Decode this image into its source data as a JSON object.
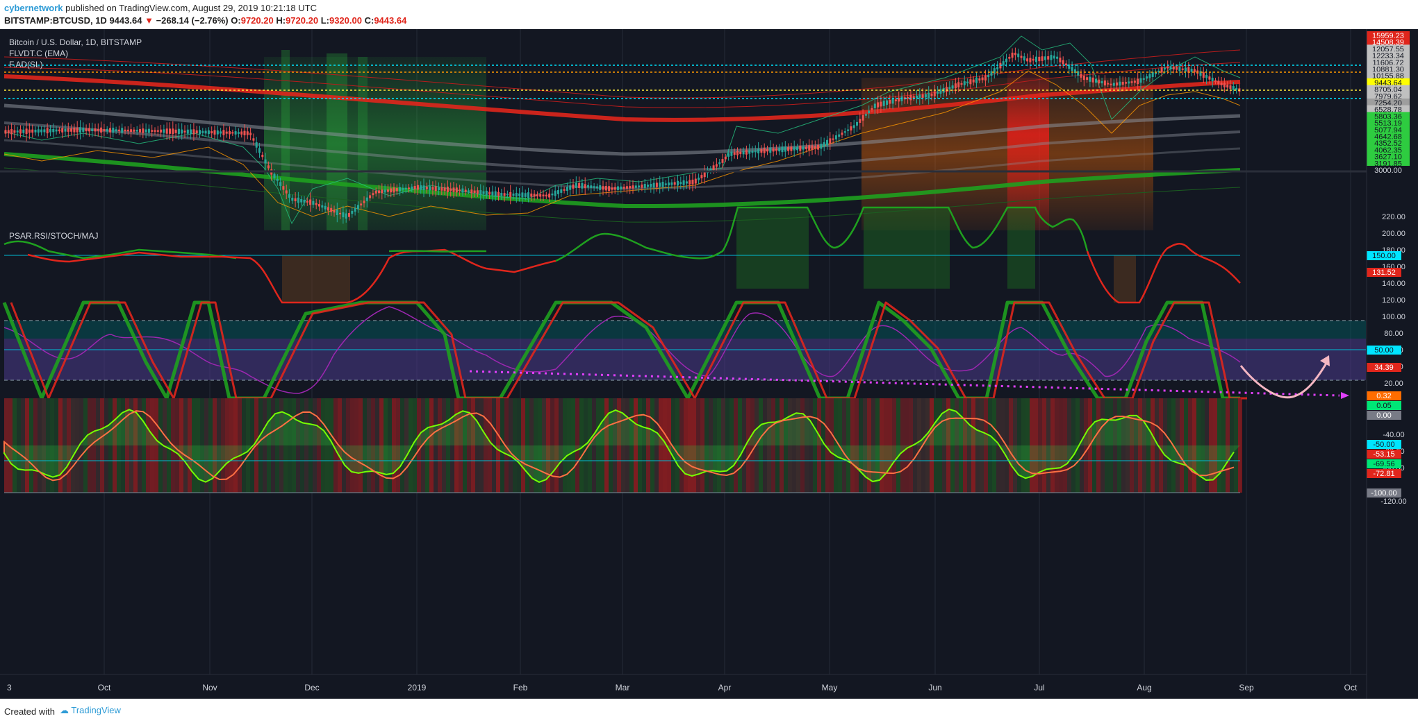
{
  "header": {
    "author": "cybernetwork",
    "published_text": " published on TradingView.com, August 29, 2019 10:21:18 UTC",
    "symbol": "BITSTAMP:BTCUSD, 1D",
    "last": "9443.64",
    "change_arrow": "▼",
    "change": "−268.14 (−2.76%)",
    "ohlc_o_label": "O:",
    "ohlc_o": "9720.20",
    "ohlc_h_label": "H:",
    "ohlc_h": "9720.20",
    "ohlc_l_label": "L:",
    "ohlc_l": "9320.00",
    "ohlc_c_label": "C:",
    "ohlc_c": "9443.64"
  },
  "panes": {
    "main_title": "Bitcoin / U.S. Dollar, 1D, BITSTAMP",
    "indicator_1": "FLVDT.C (EMA)",
    "indicator_2": "F.AD(SL)",
    "lower_title": "PSAR.RSI/STOCH/MAJ"
  },
  "price_axis": {
    "ticks": [
      {
        "label": "15959.23",
        "color": "#e0261c",
        "text_color": "#ffffff"
      },
      {
        "label": "14508.39",
        "color": "#e0261c",
        "text_color": "#ffffff"
      },
      {
        "label": "12057.55",
        "color": "#c0c0c0",
        "text_color": "#131722"
      },
      {
        "label": "12233.34",
        "color": "#c0c0c0",
        "text_color": "#131722"
      },
      {
        "label": "11606.72",
        "color": "#c0c0c0",
        "text_color": "#131722"
      },
      {
        "label": "10881.30",
        "color": "#c0c0c0",
        "text_color": "#131722"
      },
      {
        "label": "10155.88",
        "color": "#c0c0c0",
        "text_color": "#131722"
      },
      {
        "label": "9443.64",
        "color": "#ffff00",
        "text_color": "#131722"
      },
      {
        "label": "8705.04",
        "color": "#c0c0c0",
        "text_color": "#131722"
      },
      {
        "label": "7979.62",
        "color": "#c0c0c0",
        "text_color": "#131722"
      },
      {
        "label": "7254.20",
        "color": "#9e9e9e",
        "text_color": "#131722"
      },
      {
        "label": "6528.78",
        "color": "#c0c0c0",
        "text_color": "#131722"
      },
      {
        "label": "5803.36",
        "color": "#2ecc40",
        "text_color": "#131722"
      },
      {
        "label": "5513.19",
        "color": "#2ecc40",
        "text_color": "#131722"
      },
      {
        "label": "5077.94",
        "color": "#2ecc40",
        "text_color": "#131722"
      },
      {
        "label": "4642.68",
        "color": "#2ecc40",
        "text_color": "#131722"
      },
      {
        "label": "4352.52",
        "color": "#2ecc40",
        "text_color": "#131722"
      },
      {
        "label": "4062.35",
        "color": "#2ecc40",
        "text_color": "#131722"
      },
      {
        "label": "3627.10",
        "color": "#2ecc40",
        "text_color": "#131722"
      },
      {
        "label": "3191.85",
        "color": "#2ecc40",
        "text_color": "#131722"
      },
      {
        "label": "3000.00",
        "color": "#131722",
        "text_color": "#d1d4dc"
      }
    ]
  },
  "osc_axis": {
    "ticks": [
      "220.00",
      "200.00",
      "180.00",
      "160.00",
      "140.00",
      "120.00",
      "100.00",
      "80.00",
      "60.00",
      "40.00",
      "20.00",
      "-40.00",
      "-60.00",
      "-80.00",
      "-120.00"
    ],
    "tags": [
      {
        "label": "150.00",
        "color": "#00e5ff",
        "text_color": "#131722"
      },
      {
        "label": "131.52",
        "color": "#e0261c",
        "text_color": "#ffffff"
      },
      {
        "label": "50.00",
        "color": "#00e5ff",
        "text_color": "#131722"
      },
      {
        "label": "34.39",
        "color": "#e0261c",
        "text_color": "#ffffff"
      },
      {
        "label": "0.32",
        "color": "#ff6d00",
        "text_color": "#ffffff"
      },
      {
        "label": "0.05",
        "color": "#00e676",
        "text_color": "#131722"
      },
      {
        "label": "0.00",
        "color": "#787b86",
        "text_color": "#ffffff"
      },
      {
        "label": "-50.00",
        "color": "#00e5ff",
        "text_color": "#131722"
      },
      {
        "label": "-53.15",
        "color": "#e0261c",
        "text_color": "#ffffff"
      },
      {
        "label": "-69.56",
        "color": "#00e676",
        "text_color": "#131722"
      },
      {
        "label": "-72.81",
        "color": "#e0261c",
        "text_color": "#ffffff"
      },
      {
        "label": "-100.00",
        "color": "#787b86",
        "text_color": "#ffffff"
      }
    ]
  },
  "time_axis": {
    "labels": [
      "3",
      "Oct",
      "Nov",
      "Dec",
      "2019",
      "Feb",
      "Mar",
      "Apr",
      "May",
      "Jun",
      "Jul",
      "Aug",
      "Sep",
      "Oct"
    ]
  },
  "colors": {
    "background": "#131722",
    "bull": "#26a69a",
    "bear": "#ef5350",
    "green_band": "#1fa01f",
    "red_band": "#d32f2f",
    "magenta": "#e040fb",
    "arrow": "#f4b6c2"
  },
  "footer": {
    "created_with": "Created with",
    "brand": "TradingView",
    "brand_icon": "tradingview-logo-icon"
  }
}
